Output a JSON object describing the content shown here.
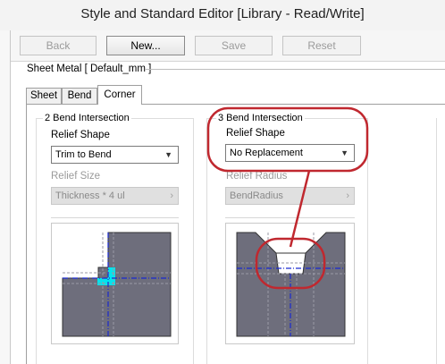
{
  "window": {
    "title": "Style and Standard Editor [Library - Read/Write]"
  },
  "toolbar": {
    "back_label": "Back",
    "new_label": "New...",
    "save_label": "Save",
    "reset_label": "Reset"
  },
  "sheet_metal_title": "Sheet Metal [ Default_mm ]",
  "tabs": [
    {
      "label": "Sheet",
      "active": false
    },
    {
      "label": "Bend",
      "active": false
    },
    {
      "label": "Corner",
      "active": true
    }
  ],
  "two_bend": {
    "title": "2 Bend Intersection",
    "relief_shape_label": "Relief Shape",
    "relief_shape_value": "Trim to Bend",
    "relief_size_label": "Relief Size",
    "relief_size_value": "Thickness * 4 ul"
  },
  "three_bend": {
    "title": "3 Bend Intersection",
    "relief_shape_label": "Relief Shape",
    "relief_shape_value": "No Replacement",
    "relief_radius_label": "Relief Radius",
    "relief_radius_value": "BendRadius"
  },
  "icons": {
    "dropdown": "chevron-down-icon",
    "expression": "arrow-right-icon"
  },
  "colors": {
    "sheet_gray": "#6e6e7c",
    "relief_cyan": "#00e5ee",
    "centerline_blue": "#1a2ad0",
    "callout_red": "#c0282f"
  }
}
